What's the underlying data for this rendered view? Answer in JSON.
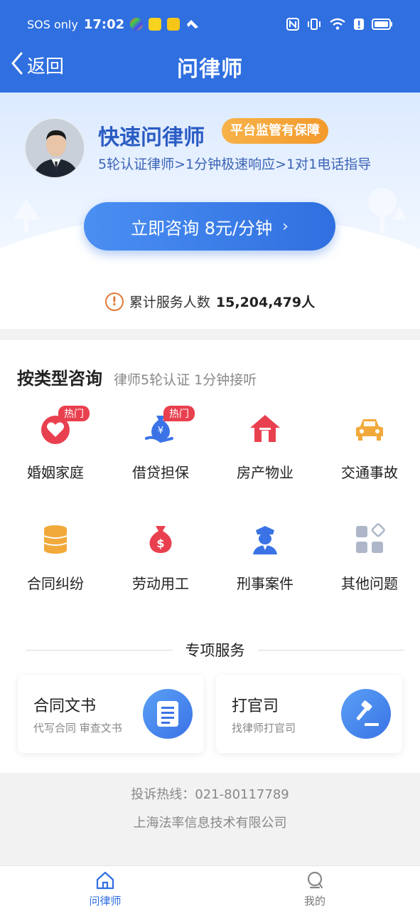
{
  "status_bar": {
    "carrier": "SOS only",
    "time": "17:02"
  },
  "header": {
    "back_label": "返回",
    "title": "问律师"
  },
  "hero": {
    "title": "快速问律师",
    "badge": "平台监管有保障",
    "subtitle": "5轮认证律师>1分钟极速响应>1对1电话指导",
    "cta_label": "立即咨询 8元/分钟",
    "cta_chevron": "›",
    "served_label": "累计服务人数",
    "served_count": "15,204,479人"
  },
  "categories": {
    "title": "按类型咨询",
    "subtitle": "律师5轮认证 1分钟接听",
    "items": [
      {
        "label": "婚姻家庭",
        "hot": "热门",
        "icon": "heart-icon"
      },
      {
        "label": "借贷担保",
        "hot": "热门",
        "icon": "money-bag-icon"
      },
      {
        "label": "房产物业",
        "icon": "house-icon"
      },
      {
        "label": "交通事故",
        "icon": "car-icon"
      },
      {
        "label": "合同纠纷",
        "icon": "coins-icon"
      },
      {
        "label": "劳动用工",
        "icon": "wage-bag-icon"
      },
      {
        "label": "刑事案件",
        "icon": "police-icon"
      },
      {
        "label": "其他问题",
        "icon": "grid-icon"
      }
    ]
  },
  "special": {
    "title": "专项服务",
    "cards": [
      {
        "title": "合同文书",
        "subtitle": "代写合同 审查文书",
        "icon": "document-icon"
      },
      {
        "title": "打官司",
        "subtitle": "找律师打官司",
        "icon": "gavel-icon"
      }
    ]
  },
  "footer": {
    "hotline": "投诉热线：021-80117789",
    "company": "上海法率信息技术有限公司"
  },
  "tabs": [
    {
      "label": "问律师",
      "active": true,
      "icon": "home-icon"
    },
    {
      "label": "我的",
      "active": false,
      "icon": "user-icon"
    }
  ],
  "colors": {
    "brand": "#2f6fe0",
    "hot": "#e9404f",
    "badge": "#f39a2c"
  }
}
